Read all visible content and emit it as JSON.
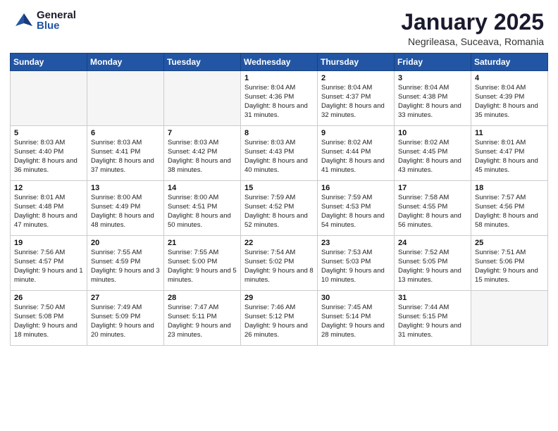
{
  "logo": {
    "general": "General",
    "blue": "Blue"
  },
  "title": {
    "main": "January 2025",
    "sub": "Negrileasa, Suceava, Romania"
  },
  "weekdays": [
    "Sunday",
    "Monday",
    "Tuesday",
    "Wednesday",
    "Thursday",
    "Friday",
    "Saturday"
  ],
  "weeks": [
    [
      {
        "day": "",
        "info": ""
      },
      {
        "day": "",
        "info": ""
      },
      {
        "day": "",
        "info": ""
      },
      {
        "day": "1",
        "info": "Sunrise: 8:04 AM\nSunset: 4:36 PM\nDaylight: 8 hours and 31 minutes."
      },
      {
        "day": "2",
        "info": "Sunrise: 8:04 AM\nSunset: 4:37 PM\nDaylight: 8 hours and 32 minutes."
      },
      {
        "day": "3",
        "info": "Sunrise: 8:04 AM\nSunset: 4:38 PM\nDaylight: 8 hours and 33 minutes."
      },
      {
        "day": "4",
        "info": "Sunrise: 8:04 AM\nSunset: 4:39 PM\nDaylight: 8 hours and 35 minutes."
      }
    ],
    [
      {
        "day": "5",
        "info": "Sunrise: 8:03 AM\nSunset: 4:40 PM\nDaylight: 8 hours and 36 minutes."
      },
      {
        "day": "6",
        "info": "Sunrise: 8:03 AM\nSunset: 4:41 PM\nDaylight: 8 hours and 37 minutes."
      },
      {
        "day": "7",
        "info": "Sunrise: 8:03 AM\nSunset: 4:42 PM\nDaylight: 8 hours and 38 minutes."
      },
      {
        "day": "8",
        "info": "Sunrise: 8:03 AM\nSunset: 4:43 PM\nDaylight: 8 hours and 40 minutes."
      },
      {
        "day": "9",
        "info": "Sunrise: 8:02 AM\nSunset: 4:44 PM\nDaylight: 8 hours and 41 minutes."
      },
      {
        "day": "10",
        "info": "Sunrise: 8:02 AM\nSunset: 4:45 PM\nDaylight: 8 hours and 43 minutes."
      },
      {
        "day": "11",
        "info": "Sunrise: 8:01 AM\nSunset: 4:47 PM\nDaylight: 8 hours and 45 minutes."
      }
    ],
    [
      {
        "day": "12",
        "info": "Sunrise: 8:01 AM\nSunset: 4:48 PM\nDaylight: 8 hours and 47 minutes."
      },
      {
        "day": "13",
        "info": "Sunrise: 8:00 AM\nSunset: 4:49 PM\nDaylight: 8 hours and 48 minutes."
      },
      {
        "day": "14",
        "info": "Sunrise: 8:00 AM\nSunset: 4:51 PM\nDaylight: 8 hours and 50 minutes."
      },
      {
        "day": "15",
        "info": "Sunrise: 7:59 AM\nSunset: 4:52 PM\nDaylight: 8 hours and 52 minutes."
      },
      {
        "day": "16",
        "info": "Sunrise: 7:59 AM\nSunset: 4:53 PM\nDaylight: 8 hours and 54 minutes."
      },
      {
        "day": "17",
        "info": "Sunrise: 7:58 AM\nSunset: 4:55 PM\nDaylight: 8 hours and 56 minutes."
      },
      {
        "day": "18",
        "info": "Sunrise: 7:57 AM\nSunset: 4:56 PM\nDaylight: 8 hours and 58 minutes."
      }
    ],
    [
      {
        "day": "19",
        "info": "Sunrise: 7:56 AM\nSunset: 4:57 PM\nDaylight: 9 hours and 1 minute."
      },
      {
        "day": "20",
        "info": "Sunrise: 7:55 AM\nSunset: 4:59 PM\nDaylight: 9 hours and 3 minutes."
      },
      {
        "day": "21",
        "info": "Sunrise: 7:55 AM\nSunset: 5:00 PM\nDaylight: 9 hours and 5 minutes."
      },
      {
        "day": "22",
        "info": "Sunrise: 7:54 AM\nSunset: 5:02 PM\nDaylight: 9 hours and 8 minutes."
      },
      {
        "day": "23",
        "info": "Sunrise: 7:53 AM\nSunset: 5:03 PM\nDaylight: 9 hours and 10 minutes."
      },
      {
        "day": "24",
        "info": "Sunrise: 7:52 AM\nSunset: 5:05 PM\nDaylight: 9 hours and 13 minutes."
      },
      {
        "day": "25",
        "info": "Sunrise: 7:51 AM\nSunset: 5:06 PM\nDaylight: 9 hours and 15 minutes."
      }
    ],
    [
      {
        "day": "26",
        "info": "Sunrise: 7:50 AM\nSunset: 5:08 PM\nDaylight: 9 hours and 18 minutes."
      },
      {
        "day": "27",
        "info": "Sunrise: 7:49 AM\nSunset: 5:09 PM\nDaylight: 9 hours and 20 minutes."
      },
      {
        "day": "28",
        "info": "Sunrise: 7:47 AM\nSunset: 5:11 PM\nDaylight: 9 hours and 23 minutes."
      },
      {
        "day": "29",
        "info": "Sunrise: 7:46 AM\nSunset: 5:12 PM\nDaylight: 9 hours and 26 minutes."
      },
      {
        "day": "30",
        "info": "Sunrise: 7:45 AM\nSunset: 5:14 PM\nDaylight: 9 hours and 28 minutes."
      },
      {
        "day": "31",
        "info": "Sunrise: 7:44 AM\nSunset: 5:15 PM\nDaylight: 9 hours and 31 minutes."
      },
      {
        "day": "",
        "info": ""
      }
    ]
  ]
}
